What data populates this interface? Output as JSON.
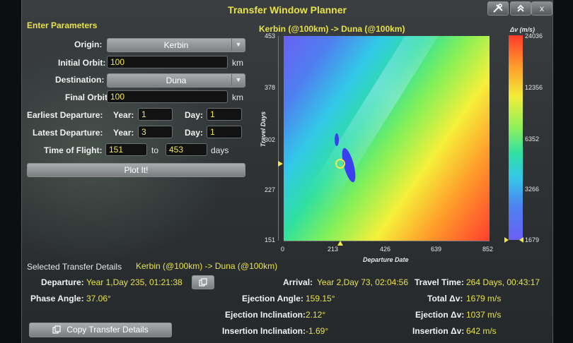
{
  "window": {
    "title": "Transfer Window Planner"
  },
  "titlebar_icons": [
    "settings-icon",
    "collapse-icon",
    "close-icon"
  ],
  "close_label": "x",
  "params": {
    "header": "Enter Parameters",
    "origin_label": "Origin:",
    "origin_value": "Kerbin",
    "initial_orbit_label": "Initial Orbit:",
    "initial_orbit_value": "100",
    "destination_label": "Destination:",
    "destination_value": "Duna",
    "final_orbit_label": "Final Orbit:",
    "final_orbit_value": "100",
    "unit_km": "km",
    "earliest_label": "Earliest Departure:",
    "latest_label": "Latest Departure:",
    "year_label": "Year:",
    "day_label": "Day:",
    "earliest_year": "1",
    "earliest_day": "1",
    "latest_year": "3",
    "latest_day": "1",
    "tof_label": "Time of Flight:",
    "tof_min": "151",
    "tof_to": "to",
    "tof_max": "453",
    "tof_unit": "days",
    "plot_button": "Plot It!"
  },
  "plot": {
    "title": "Kerbin (@100km) -> Duna (@100km)",
    "colorbar_title": "Δv (m/s)",
    "colorbar_ticks": [
      "24036",
      "12356",
      "6352",
      "3266",
      "1679"
    ],
    "y_label": "Travel Days",
    "y_ticks": [
      "453",
      "378",
      "302",
      "227",
      "151"
    ],
    "x_label": "Departure Date",
    "x_ticks": [
      "0",
      "213",
      "426",
      "639",
      "852"
    ],
    "selected_departure_day": 235,
    "selected_travel_days": 264
  },
  "details": {
    "header": "Selected Transfer Details",
    "route": "Kerbin (@100km) -> Duna (@100km)",
    "departure_label": "Departure:",
    "departure_value": "Year 1,Day 235, 01:21:38",
    "arrival_label": "Arrival:",
    "arrival_value": "Year 2,Day 73, 02:04:56",
    "travel_time_label": "Travel Time:",
    "travel_time_value": "264 Days, 00:43:17",
    "phase_angle_label": "Phase Angle:",
    "phase_angle_value": "37.06°",
    "ejection_angle_label": "Ejection Angle:",
    "ejection_angle_value": "159.15°",
    "total_dv_label": "Total Δv:",
    "total_dv_value": "1679 m/s",
    "ejection_incl_label": "Ejection Inclination:",
    "ejection_incl_value": "2.12°",
    "ejection_dv_label": "Ejection Δv:",
    "ejection_dv_value": "1037 m/s",
    "insertion_incl_label": "Insertion Inclination:",
    "insertion_incl_value": "-1.69°",
    "insertion_dv_label": "Insertion Δv:",
    "insertion_dv_value": "642 m/s",
    "copy_button": "Copy Transfer Details"
  }
}
